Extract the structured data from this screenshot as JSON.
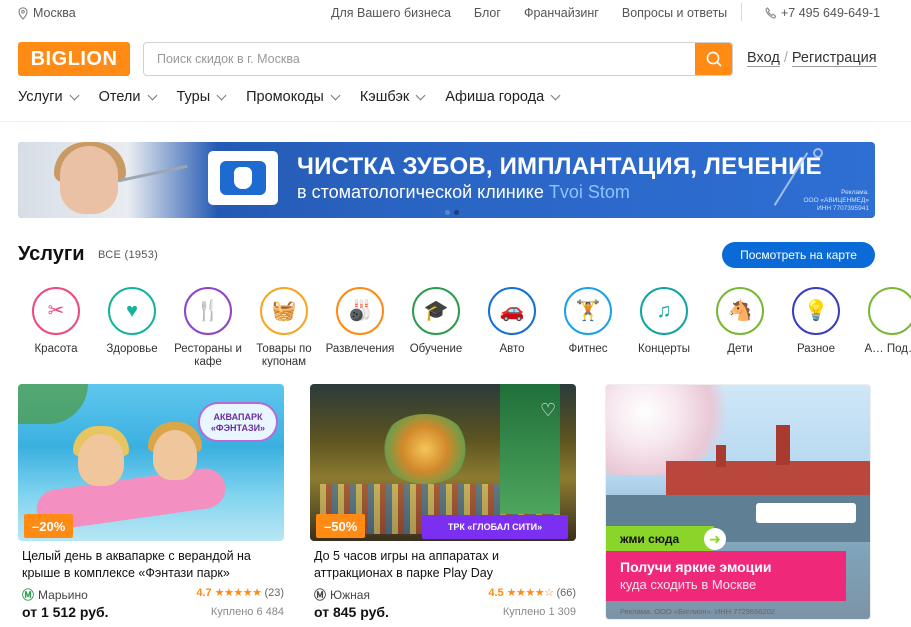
{
  "colors": {
    "brand": "#ff8a14",
    "accent_blue": "#0a6ad8",
    "metro_green": "#2aa14c",
    "promo_pink": "#f0287a",
    "promo_green": "#8bd42a"
  },
  "topbar": {
    "city": "Москва",
    "links": [
      "Для Вашего бизнеса",
      "Блог",
      "Франчайзинг",
      "Вопросы и ответы"
    ],
    "phone": "+7 495 649-649-1"
  },
  "header": {
    "logo": "BIGLION",
    "search_placeholder": "Поиск скидок в г. Москва",
    "login": "Вход",
    "register": "Регистрация"
  },
  "nav": [
    "Услуги",
    "Отели",
    "Туры",
    "Промокоды",
    "Кэшбэк",
    "Афиша города"
  ],
  "banner": {
    "line1": "ЧИСТКА ЗУБОВ, ИМПЛАНТАЦИЯ, ЛЕЧЕНИЕ",
    "line2_prefix": "в стоматологической клинике ",
    "line2_brand": "Tvoi Stom",
    "ad1": "Реклама.",
    "ad2": "ООО «АВИЦЕНМЕД»",
    "ad3": "ИНН 7707395941"
  },
  "section": {
    "title": "Услуги",
    "count": "ВСЕ (1953)",
    "map_button": "Посмотреть на карте"
  },
  "categories": [
    {
      "label": "Красота",
      "icon": "scissors-comb-icon",
      "color": "#e94b7a",
      "glyph": "✂"
    },
    {
      "label": "Здоровье",
      "icon": "heart-pulse-icon",
      "color": "#16b39b",
      "glyph": "♥"
    },
    {
      "label": "Рестораны и кафе",
      "icon": "fork-knife-icon",
      "color": "#8e44c9",
      "glyph": "🍴"
    },
    {
      "label": "Товары по купонам",
      "icon": "basket-icon",
      "color": "#f5a623",
      "glyph": "🧺"
    },
    {
      "label": "Развлечения",
      "icon": "bowling-icon",
      "color": "#ff8a14",
      "glyph": "🎳"
    },
    {
      "label": "Обучение",
      "icon": "graduation-cap-icon",
      "color": "#2e9c4f",
      "glyph": "🎓"
    },
    {
      "label": "Авто",
      "icon": "car-icon",
      "color": "#1570d3",
      "glyph": "🚗"
    },
    {
      "label": "Фитнес",
      "icon": "dumbbell-icon",
      "color": "#1ea0e6",
      "glyph": "🏋"
    },
    {
      "label": "Концерты",
      "icon": "music-note-icon",
      "color": "#14a3a3",
      "glyph": "♫"
    },
    {
      "label": "Дети",
      "icon": "rocking-horse-icon",
      "color": "#79b837",
      "glyph": "🐴"
    },
    {
      "label": "Разное",
      "icon": "light-bulb-icon",
      "color": "#3b3fbf",
      "glyph": "💡"
    },
    {
      "label": "А… Под…",
      "icon": "partial-category-icon",
      "color": "#79b837",
      "glyph": ""
    }
  ],
  "cards": [
    {
      "discount": "–20%",
      "title": "Целый день в аквапарке с верандой на крыше в комплексе «Фэнтази парк»",
      "metro": "Марьино",
      "rating": "4.7",
      "stars": "★★★★★",
      "reviews": "(23)",
      "price": "от 1 512 руб.",
      "sold": "Куплено 6 484",
      "logo_text": "АКВАПАРК «ФЭНТАЗИ»"
    },
    {
      "discount": "–50%",
      "title": "До 5 часов игры на аппаратах и аттракционах в парке Play Day",
      "metro": "Южная",
      "rating": "4.5",
      "stars": "★★★★☆",
      "reviews": "(66)",
      "price": "от 845 руб.",
      "sold": "Куплено 1 309",
      "tag": "ТРК «ГЛОБАЛ СИТИ»"
    }
  ],
  "promo": {
    "cta": "жми сюда",
    "headline": "Получи яркие эмоции",
    "sub": "куда сходить в Москве",
    "ad": "Реклама. ООО «Биглион». ИНН 7729656202"
  }
}
